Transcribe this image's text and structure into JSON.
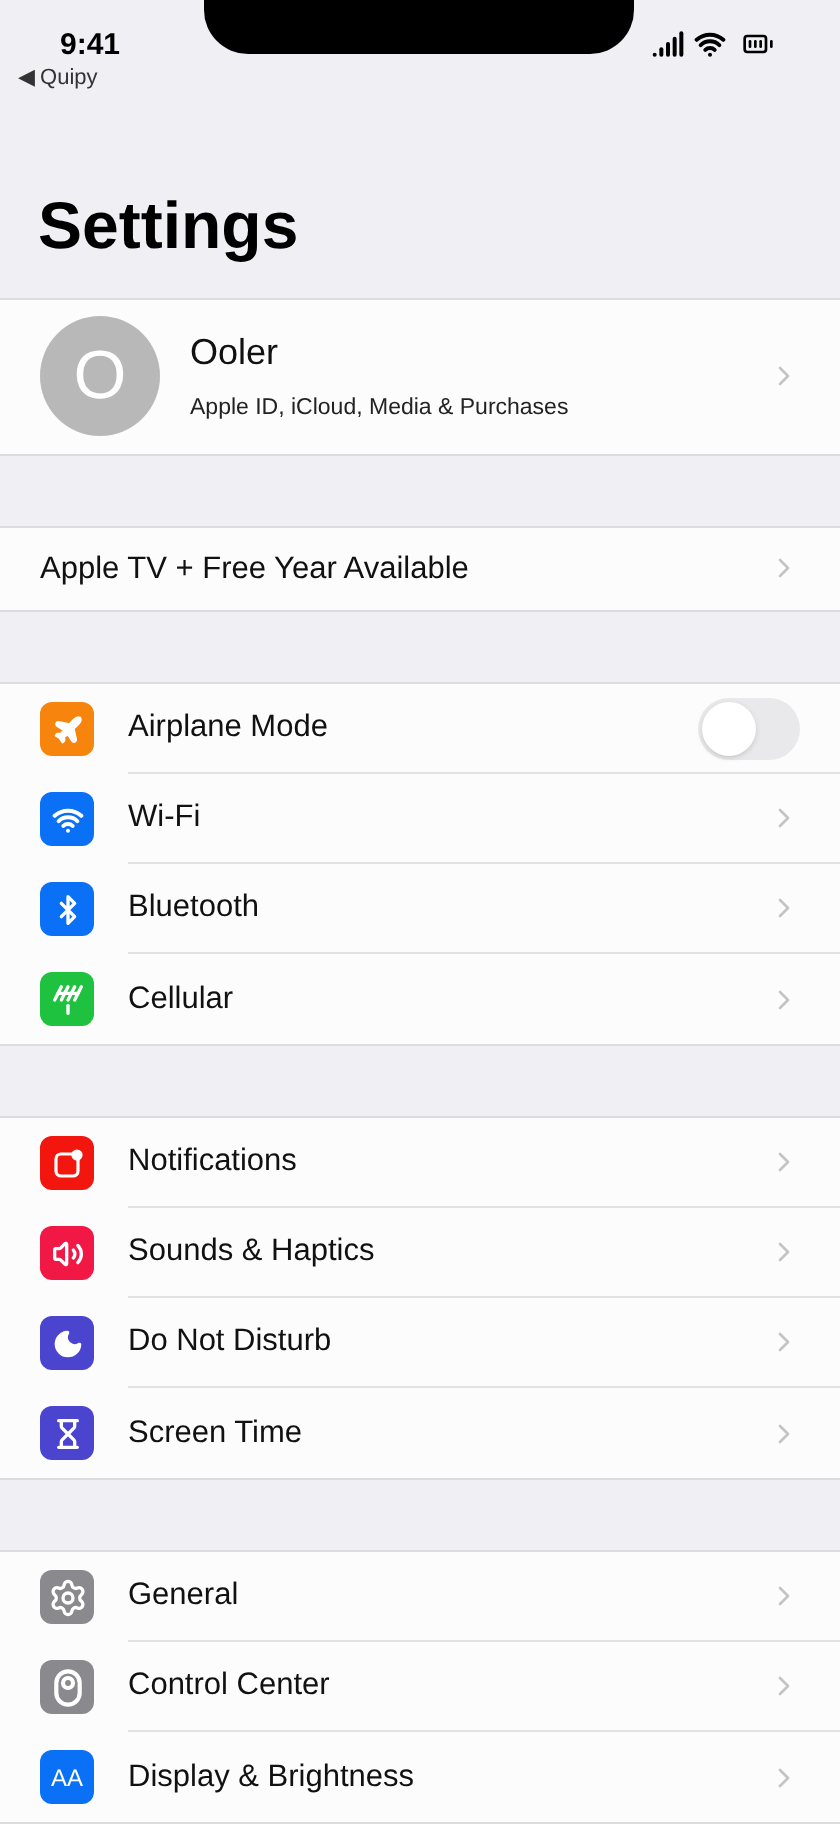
{
  "status_bar": {
    "time": "9:41",
    "back_label": "◀ Quipy"
  },
  "title": "Settings",
  "profile": {
    "initial": "O",
    "name": "Ooler",
    "subtitle": "Apple ID, iCloud, Media & Purchases"
  },
  "promo": {
    "label": "Apple TV + Free Year Available"
  },
  "groups": [
    {
      "items": [
        {
          "color": "#f7840c",
          "label": "Airplane Mode",
          "kind": "toggle",
          "on": false
        },
        {
          "color": "#0a70f5",
          "label": "Wi-Fi",
          "kind": "link"
        },
        {
          "color": "#0a70f5",
          "label": "Bluetooth",
          "kind": "link"
        },
        {
          "color": "#1ec23f",
          "label": "Cellular",
          "kind": "link"
        }
      ]
    },
    {
      "items": [
        {
          "color": "#f2160f",
          "label": "Notifications",
          "kind": "link"
        },
        {
          "color": "#f21845",
          "label": "Sounds & Haptics",
          "kind": "link"
        },
        {
          "color": "#4a44cf",
          "label": "Do Not Disturb",
          "kind": "link"
        },
        {
          "color": "#4a44cf",
          "label": "Screen Time",
          "kind": "link"
        }
      ]
    },
    {
      "items": [
        {
          "color": "#8a8a8e",
          "label": "General",
          "kind": "link"
        },
        {
          "color": "#8a8a8e",
          "label": "Control Center",
          "kind": "link"
        },
        {
          "icon_text": "AA",
          "color": "#0a70f5",
          "label": "Display & Brightness",
          "kind": "link"
        }
      ]
    }
  ]
}
